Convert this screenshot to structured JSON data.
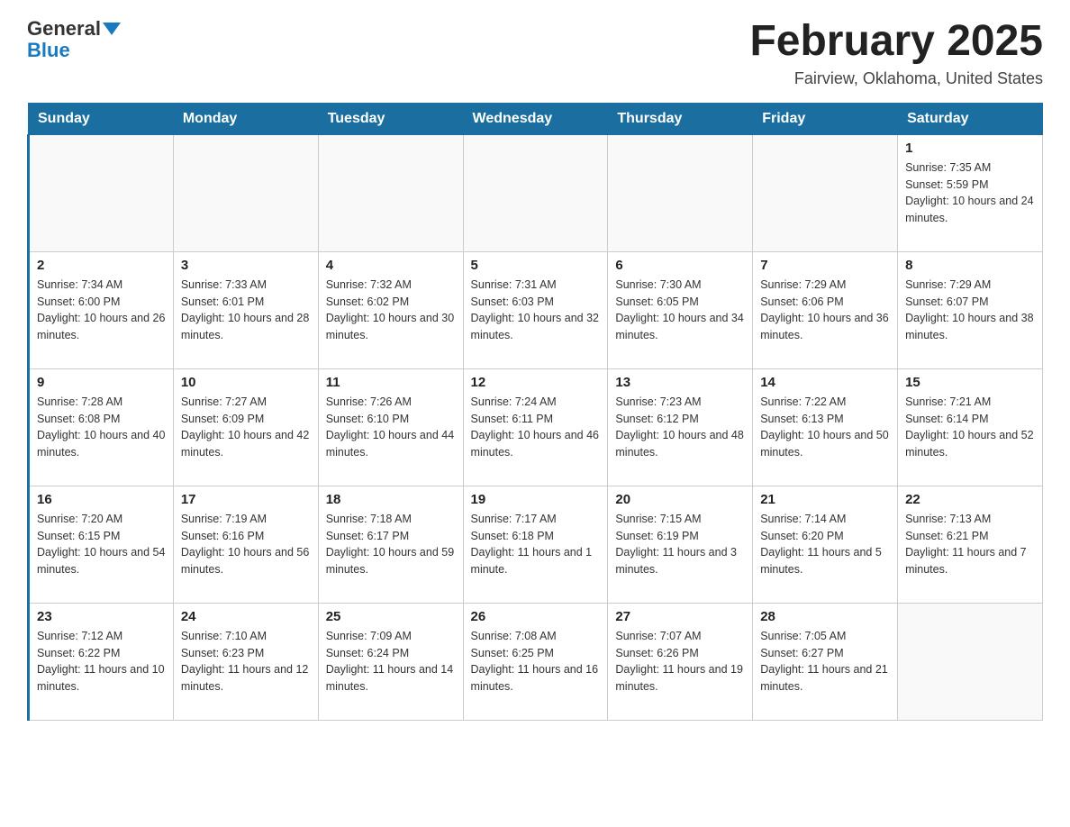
{
  "header": {
    "logo_general": "General",
    "logo_blue": "Blue",
    "month_title": "February 2025",
    "location": "Fairview, Oklahoma, United States"
  },
  "days_of_week": [
    "Sunday",
    "Monday",
    "Tuesday",
    "Wednesday",
    "Thursday",
    "Friday",
    "Saturday"
  ],
  "weeks": [
    [
      {
        "day": "",
        "sunrise": "",
        "sunset": "",
        "daylight": ""
      },
      {
        "day": "",
        "sunrise": "",
        "sunset": "",
        "daylight": ""
      },
      {
        "day": "",
        "sunrise": "",
        "sunset": "",
        "daylight": ""
      },
      {
        "day": "",
        "sunrise": "",
        "sunset": "",
        "daylight": ""
      },
      {
        "day": "",
        "sunrise": "",
        "sunset": "",
        "daylight": ""
      },
      {
        "day": "",
        "sunrise": "",
        "sunset": "",
        "daylight": ""
      },
      {
        "day": "1",
        "sunrise": "Sunrise: 7:35 AM",
        "sunset": "Sunset: 5:59 PM",
        "daylight": "Daylight: 10 hours and 24 minutes."
      }
    ],
    [
      {
        "day": "2",
        "sunrise": "Sunrise: 7:34 AM",
        "sunset": "Sunset: 6:00 PM",
        "daylight": "Daylight: 10 hours and 26 minutes."
      },
      {
        "day": "3",
        "sunrise": "Sunrise: 7:33 AM",
        "sunset": "Sunset: 6:01 PM",
        "daylight": "Daylight: 10 hours and 28 minutes."
      },
      {
        "day": "4",
        "sunrise": "Sunrise: 7:32 AM",
        "sunset": "Sunset: 6:02 PM",
        "daylight": "Daylight: 10 hours and 30 minutes."
      },
      {
        "day": "5",
        "sunrise": "Sunrise: 7:31 AM",
        "sunset": "Sunset: 6:03 PM",
        "daylight": "Daylight: 10 hours and 32 minutes."
      },
      {
        "day": "6",
        "sunrise": "Sunrise: 7:30 AM",
        "sunset": "Sunset: 6:05 PM",
        "daylight": "Daylight: 10 hours and 34 minutes."
      },
      {
        "day": "7",
        "sunrise": "Sunrise: 7:29 AM",
        "sunset": "Sunset: 6:06 PM",
        "daylight": "Daylight: 10 hours and 36 minutes."
      },
      {
        "day": "8",
        "sunrise": "Sunrise: 7:29 AM",
        "sunset": "Sunset: 6:07 PM",
        "daylight": "Daylight: 10 hours and 38 minutes."
      }
    ],
    [
      {
        "day": "9",
        "sunrise": "Sunrise: 7:28 AM",
        "sunset": "Sunset: 6:08 PM",
        "daylight": "Daylight: 10 hours and 40 minutes."
      },
      {
        "day": "10",
        "sunrise": "Sunrise: 7:27 AM",
        "sunset": "Sunset: 6:09 PM",
        "daylight": "Daylight: 10 hours and 42 minutes."
      },
      {
        "day": "11",
        "sunrise": "Sunrise: 7:26 AM",
        "sunset": "Sunset: 6:10 PM",
        "daylight": "Daylight: 10 hours and 44 minutes."
      },
      {
        "day": "12",
        "sunrise": "Sunrise: 7:24 AM",
        "sunset": "Sunset: 6:11 PM",
        "daylight": "Daylight: 10 hours and 46 minutes."
      },
      {
        "day": "13",
        "sunrise": "Sunrise: 7:23 AM",
        "sunset": "Sunset: 6:12 PM",
        "daylight": "Daylight: 10 hours and 48 minutes."
      },
      {
        "day": "14",
        "sunrise": "Sunrise: 7:22 AM",
        "sunset": "Sunset: 6:13 PM",
        "daylight": "Daylight: 10 hours and 50 minutes."
      },
      {
        "day": "15",
        "sunrise": "Sunrise: 7:21 AM",
        "sunset": "Sunset: 6:14 PM",
        "daylight": "Daylight: 10 hours and 52 minutes."
      }
    ],
    [
      {
        "day": "16",
        "sunrise": "Sunrise: 7:20 AM",
        "sunset": "Sunset: 6:15 PM",
        "daylight": "Daylight: 10 hours and 54 minutes."
      },
      {
        "day": "17",
        "sunrise": "Sunrise: 7:19 AM",
        "sunset": "Sunset: 6:16 PM",
        "daylight": "Daylight: 10 hours and 56 minutes."
      },
      {
        "day": "18",
        "sunrise": "Sunrise: 7:18 AM",
        "sunset": "Sunset: 6:17 PM",
        "daylight": "Daylight: 10 hours and 59 minutes."
      },
      {
        "day": "19",
        "sunrise": "Sunrise: 7:17 AM",
        "sunset": "Sunset: 6:18 PM",
        "daylight": "Daylight: 11 hours and 1 minute."
      },
      {
        "day": "20",
        "sunrise": "Sunrise: 7:15 AM",
        "sunset": "Sunset: 6:19 PM",
        "daylight": "Daylight: 11 hours and 3 minutes."
      },
      {
        "day": "21",
        "sunrise": "Sunrise: 7:14 AM",
        "sunset": "Sunset: 6:20 PM",
        "daylight": "Daylight: 11 hours and 5 minutes."
      },
      {
        "day": "22",
        "sunrise": "Sunrise: 7:13 AM",
        "sunset": "Sunset: 6:21 PM",
        "daylight": "Daylight: 11 hours and 7 minutes."
      }
    ],
    [
      {
        "day": "23",
        "sunrise": "Sunrise: 7:12 AM",
        "sunset": "Sunset: 6:22 PM",
        "daylight": "Daylight: 11 hours and 10 minutes."
      },
      {
        "day": "24",
        "sunrise": "Sunrise: 7:10 AM",
        "sunset": "Sunset: 6:23 PM",
        "daylight": "Daylight: 11 hours and 12 minutes."
      },
      {
        "day": "25",
        "sunrise": "Sunrise: 7:09 AM",
        "sunset": "Sunset: 6:24 PM",
        "daylight": "Daylight: 11 hours and 14 minutes."
      },
      {
        "day": "26",
        "sunrise": "Sunrise: 7:08 AM",
        "sunset": "Sunset: 6:25 PM",
        "daylight": "Daylight: 11 hours and 16 minutes."
      },
      {
        "day": "27",
        "sunrise": "Sunrise: 7:07 AM",
        "sunset": "Sunset: 6:26 PM",
        "daylight": "Daylight: 11 hours and 19 minutes."
      },
      {
        "day": "28",
        "sunrise": "Sunrise: 7:05 AM",
        "sunset": "Sunset: 6:27 PM",
        "daylight": "Daylight: 11 hours and 21 minutes."
      },
      {
        "day": "",
        "sunrise": "",
        "sunset": "",
        "daylight": ""
      }
    ]
  ]
}
